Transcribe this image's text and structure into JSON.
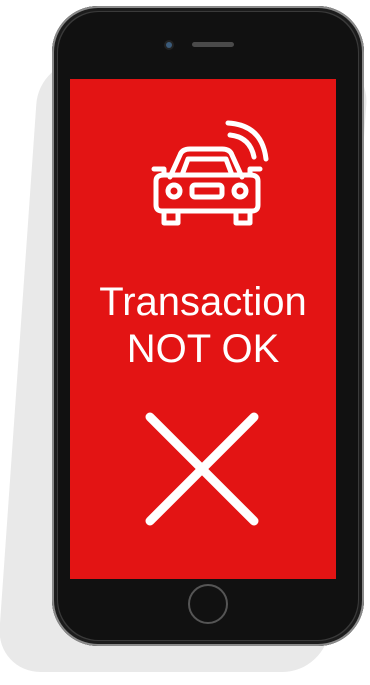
{
  "screen": {
    "status_line1": "Transaction",
    "status_line2": "NOT OK",
    "background_color": "#e31414",
    "foreground_color": "#ffffff",
    "icons": [
      "connected-car-icon",
      "cross-icon"
    ]
  },
  "device": {
    "hardware_icons": [
      "front-camera",
      "earpiece-speaker",
      "home-button"
    ]
  }
}
